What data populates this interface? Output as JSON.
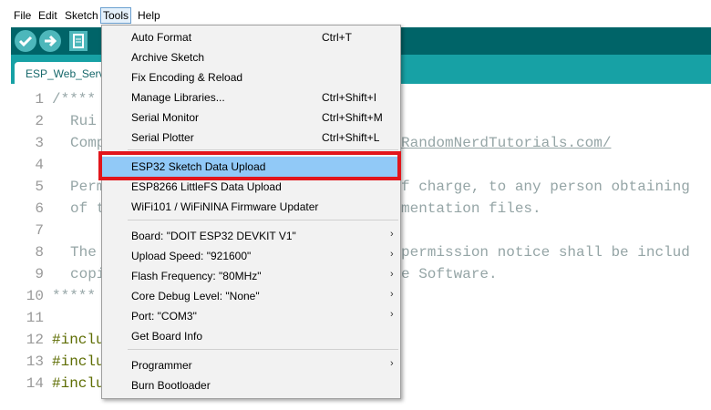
{
  "menubar": {
    "file": "File",
    "edit": "Edit",
    "sketch": "Sketch",
    "tools": "Tools",
    "help": "Help"
  },
  "tab": {
    "label": "ESP_Web_Server"
  },
  "editor": {
    "line_numbers": [
      "1",
      "2",
      "3",
      "4",
      "5",
      "6",
      "7",
      "8",
      "9",
      "10",
      "11",
      "12",
      "13",
      "14"
    ],
    "fragments": {
      "l1": "/****",
      "l2": "Rui",
      "l3a": "Comp",
      "l3b": "RandomNerdTutorials.com/",
      "l5a": "Perm",
      "l5b": "f charge, to any person obtaining",
      "l6a": "of t",
      "l6b": "mentation files.",
      "l8a": "The",
      "l8b": "permission notice shall be includ",
      "l9a": "copi",
      "l9b": "e Software.",
      "l10": "*****",
      "l12": "#inclu",
      "l13": "#inclu",
      "l14": "#inclu"
    }
  },
  "tools_menu": {
    "auto_format": {
      "label": "Auto Format",
      "shortcut": "Ctrl+T"
    },
    "archive_sketch": {
      "label": "Archive Sketch"
    },
    "fix_encoding": {
      "label": "Fix Encoding & Reload"
    },
    "manage_libraries": {
      "label": "Manage Libraries...",
      "shortcut": "Ctrl+Shift+I"
    },
    "serial_monitor": {
      "label": "Serial Monitor",
      "shortcut": "Ctrl+Shift+M"
    },
    "serial_plotter": {
      "label": "Serial Plotter",
      "shortcut": "Ctrl+Shift+L"
    },
    "esp32_upload": {
      "label": "ESP32 Sketch Data Upload"
    },
    "esp8266_upload": {
      "label": "ESP8266 LittleFS Data Upload"
    },
    "wifi_updater": {
      "label": "WiFi101 / WiFiNINA Firmware Updater"
    },
    "board": {
      "label": "Board: \"DOIT ESP32 DEVKIT V1\""
    },
    "upload_speed": {
      "label": "Upload Speed: \"921600\""
    },
    "flash_frequency": {
      "label": "Flash Frequency: \"80MHz\""
    },
    "core_debug": {
      "label": "Core Debug Level: \"None\""
    },
    "port": {
      "label": "Port: \"COM3\""
    },
    "board_info": {
      "label": "Get Board Info"
    },
    "programmer": {
      "label": "Programmer"
    },
    "burn_bootloader": {
      "label": "Burn Bootloader"
    },
    "submenu_arrow": "›"
  },
  "colors": {
    "toolbar": "#006468",
    "tabstrip": "#17a1a5",
    "highlight": "#91c9f7",
    "annotation": "#e2151b"
  },
  "icons": [
    "verify-icon",
    "upload-icon",
    "new-icon"
  ]
}
